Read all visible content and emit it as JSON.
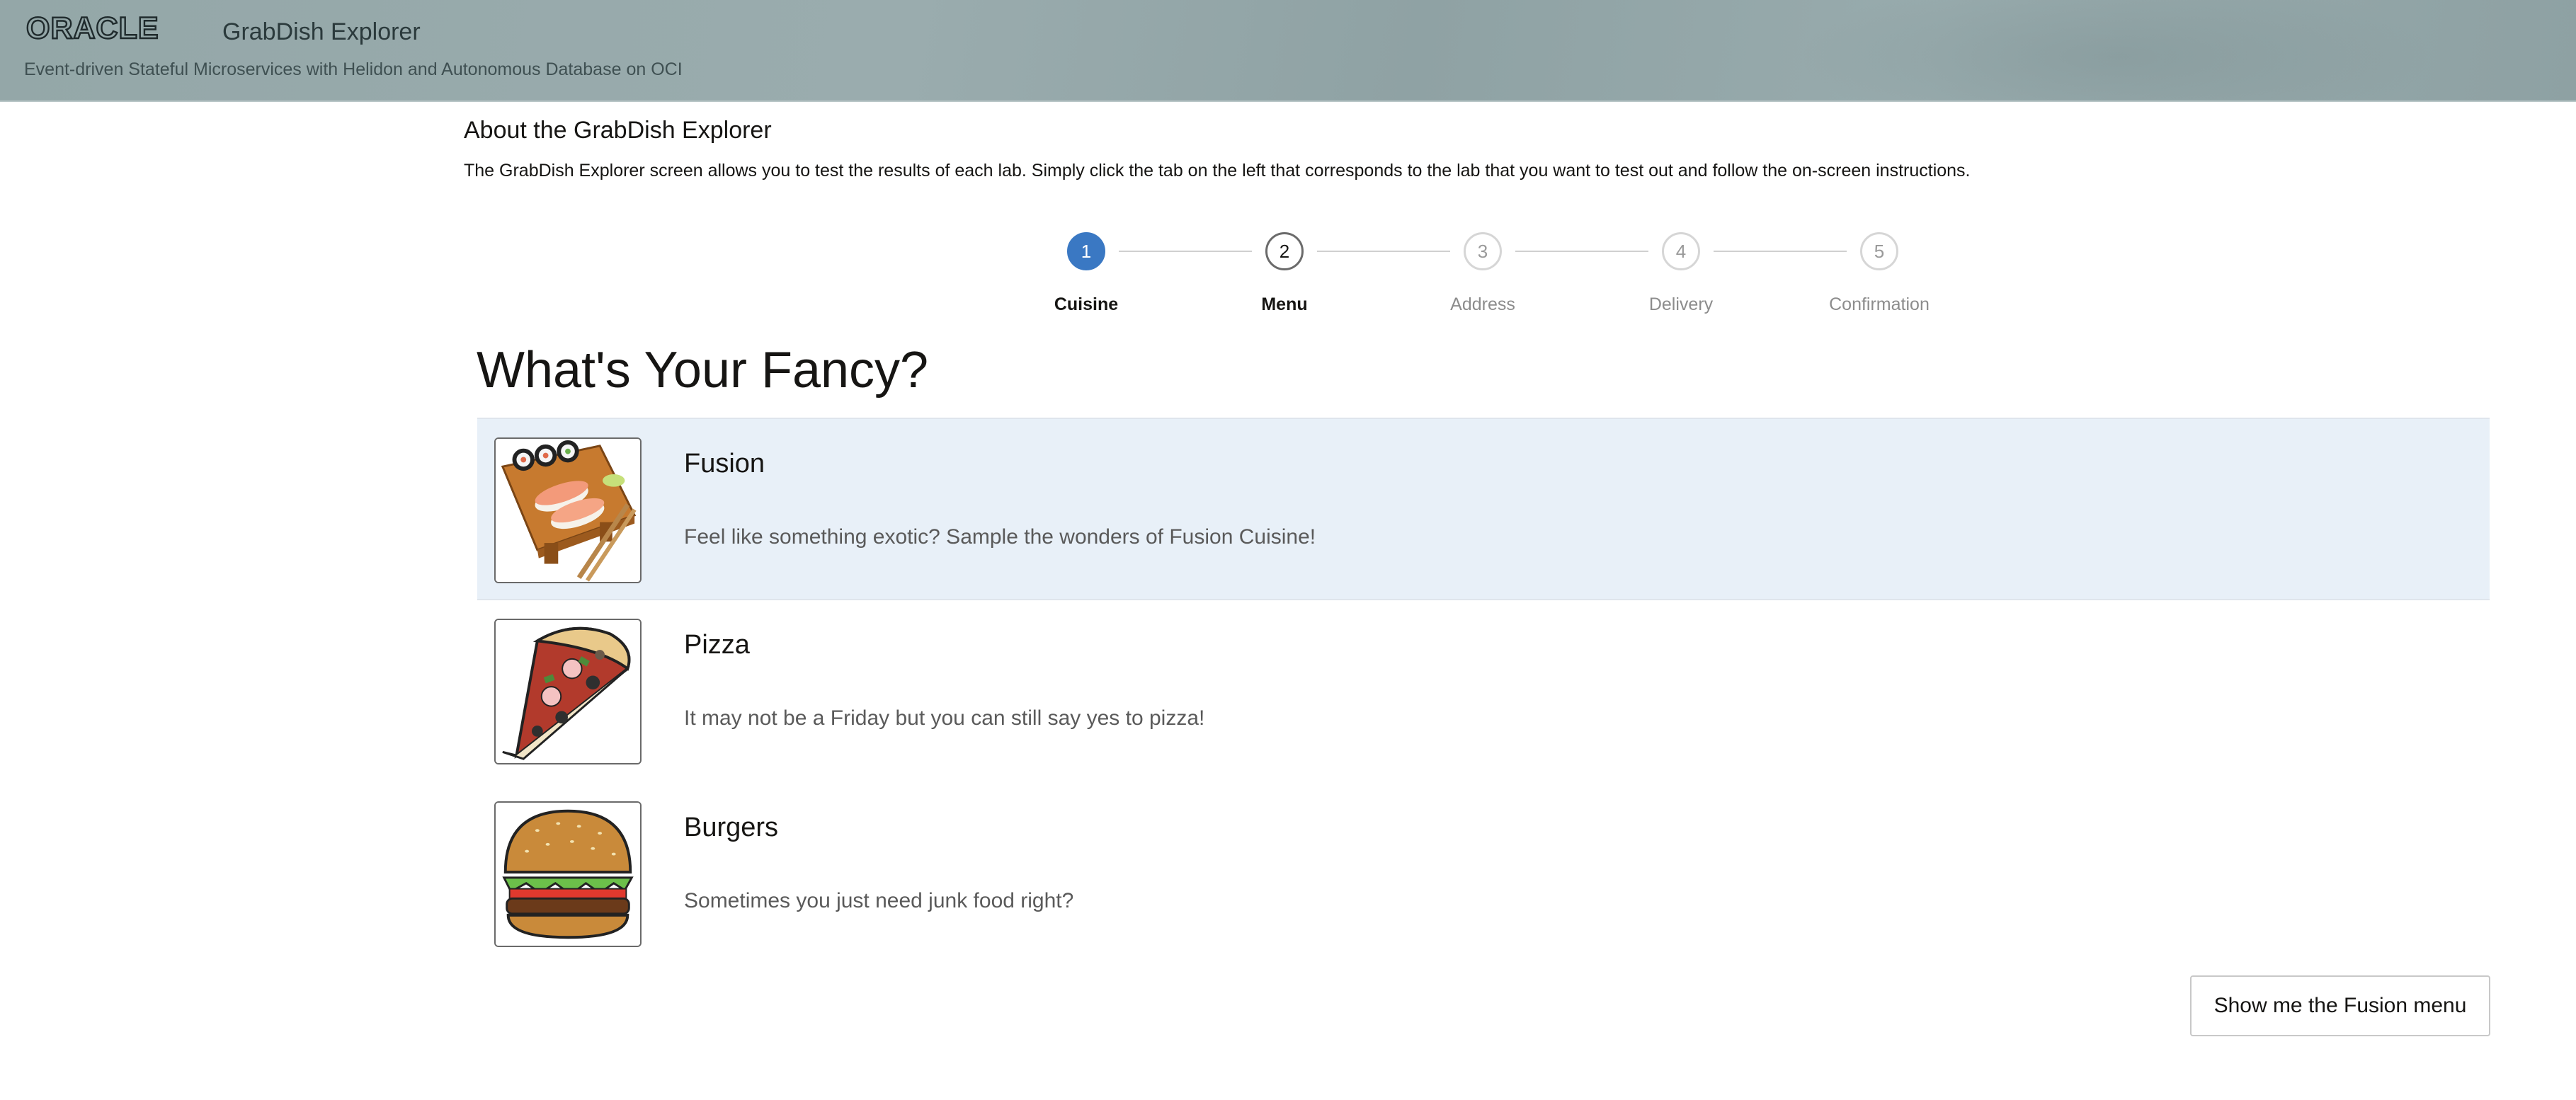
{
  "header": {
    "brand": "ORACLE",
    "app_title": "GrabDish Explorer",
    "subtitle": "Event-driven Stateful Microservices with Helidon and Autonomous Database on OCI"
  },
  "about": {
    "title": "About the GrabDish Explorer",
    "text": "The GrabDish Explorer screen allows you to test the results of each lab. Simply click the tab on the left that corresponds to the lab that you want to test out and follow the on-screen instructions."
  },
  "stepper": {
    "steps": [
      {
        "number": "1",
        "label": "Cuisine",
        "state": "active"
      },
      {
        "number": "2",
        "label": "Menu",
        "state": "current"
      },
      {
        "number": "3",
        "label": "Address",
        "state": "future"
      },
      {
        "number": "4",
        "label": "Delivery",
        "state": "future"
      },
      {
        "number": "5",
        "label": "Confirmation",
        "state": "future"
      }
    ]
  },
  "main": {
    "title": "What's Your Fancy?",
    "cuisines": [
      {
        "name": "Fusion",
        "description": "Feel like something exotic? Sample the wonders of Fusion Cuisine!",
        "icon": "sushi-icon",
        "selected": true
      },
      {
        "name": "Pizza",
        "description": "It may not be a Friday but you can still say yes to pizza!",
        "icon": "pizza-icon",
        "selected": false
      },
      {
        "name": "Burgers",
        "description": "Sometimes you just need junk food right?",
        "icon": "burger-icon",
        "selected": false
      }
    ],
    "action_label": "Show me the Fusion menu"
  },
  "colors": {
    "accent": "#3a78c3",
    "selected_row": "#e8f0f8",
    "header_bg": "#94a7a8"
  }
}
